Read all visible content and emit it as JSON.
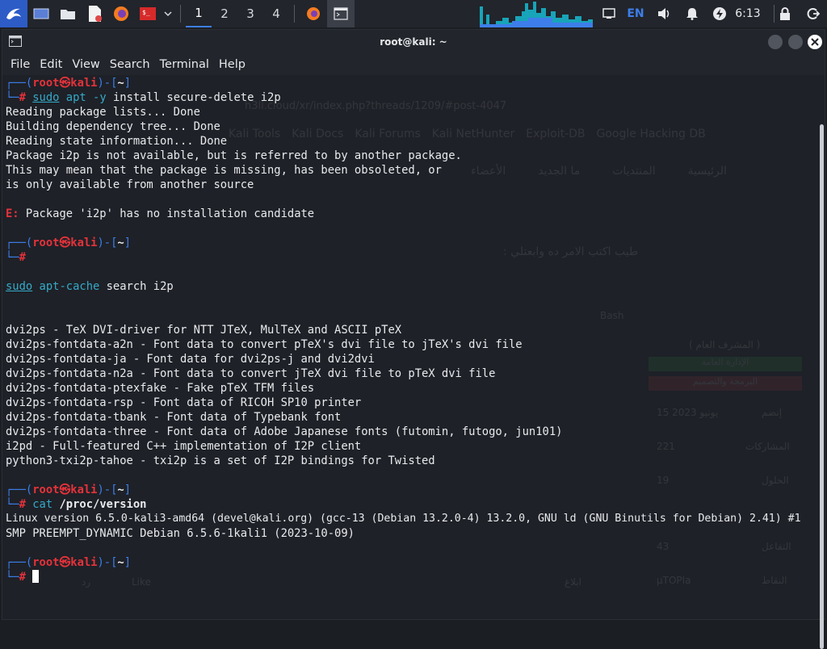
{
  "panel": {
    "workspaces": [
      "1",
      "2",
      "3",
      "4"
    ],
    "keyboard_layout": "EN",
    "clock": "6:13",
    "icons": [
      "kali-menu-icon",
      "show-desktop-icon",
      "file-manager-icon",
      "text-editor-icon",
      "firefox-icon",
      "terminal-icon",
      "window-menu-chevron-icon",
      "network-icon",
      "volume-icon",
      "notification-bell-icon",
      "power-manager-icon",
      "lock-icon",
      "logout-icon"
    ],
    "colors": {
      "panel_bg": "#22252b",
      "accent": "#3d7eea",
      "netgraph": "#17b3c9"
    }
  },
  "window": {
    "title": "root@kali: ~",
    "menu": [
      "File",
      "Edit",
      "View",
      "Search",
      "Terminal",
      "Help"
    ]
  },
  "terminal": {
    "prompt": {
      "open": "┌──(",
      "user": "root",
      "at": "㉿",
      "host": "kali",
      "mid": ")-[",
      "dir": "~",
      "close": "]",
      "second": "└─",
      "hash": "#"
    },
    "cmd1": {
      "sudo": "sudo",
      "apt": "apt",
      "flag": "-y",
      "rest": " install secure-delete i2p"
    },
    "out1": [
      "Reading package lists... Done",
      "Building dependency tree... Done",
      "Reading state information... Done",
      "Package i2p is not available, but is referred to by another package.",
      "This may mean that the package is missing, has been obsoleted, or",
      "is only available from another source"
    ],
    "error": {
      "label": "E:",
      "text": " Package 'i2p' has no installation candidate"
    },
    "cmd2": {
      "sudo": "sudo",
      "tool": "apt-cache",
      "rest": " search i2p"
    },
    "search_results": [
      "dvi2ps - TeX DVI-driver for NTT JTeX, MulTeX and ASCII pTeX",
      "dvi2ps-fontdata-a2n - Font data to convert pTeX's dvi file to jTeX's dvi file",
      "dvi2ps-fontdata-ja - Font data for dvi2ps-j and dvi2dvi",
      "dvi2ps-fontdata-n2a - Font data to convert jTeX dvi file to pTeX dvi file",
      "dvi2ps-fontdata-ptexfake - Fake pTeX TFM files",
      "dvi2ps-fontdata-rsp - Font data of RICOH SP10 printer",
      "dvi2ps-fontdata-tbank - Font data of Typebank font",
      "dvi2ps-fontdata-three - Font data of Adobe Japanese fonts (futomin, futogo, jun101)",
      "i2pd - Full-featured C++ implementation of I2P client",
      "python3-txi2p-tahoe - txi2p is a set of I2P bindings for Twisted"
    ],
    "cmd3": {
      "tool": "cat",
      "rest": " /proc/version"
    },
    "version": [
      "Linux version 6.5.0-kali3-amd64 (devel@kali.org) (gcc-13 (Debian 13.2.0-4) 13.2.0, GNU ld (GNU Binutils for Debian) 2.41) #1",
      "SMP PREEMPT_DYNAMIC Debian 6.5.6-1kali1 (2023-10-09)"
    ]
  },
  "background_page": {
    "url": "h3li.cloud/xr/index.php?threads/1209/#post-4047",
    "bookmarks": [
      "Kali Tools",
      "Kali Docs",
      "Kali Forums",
      "Kali NetHunter",
      "Exploit-DB",
      "Google Hacking DB"
    ],
    "nav": [
      "الرئيسية",
      "المنتديات",
      "ما الجديد",
      "الأعضاء"
    ],
    "post_text": "طيب اكتب الامر ده وابعتلي :",
    "poster_label": "Bash",
    "user_title": "( المشرف العام )",
    "badge1": "الإدارة العامة",
    "badge2": "البرمجة والتصميم",
    "stats": [
      {
        "label": "إنضم",
        "value": "15 يونيو 2023"
      },
      {
        "label": "المشاركات",
        "value": "221"
      },
      {
        "label": "الحلول",
        "value": "19"
      },
      {
        "label": "التفاعل",
        "value": "43"
      },
      {
        "label": "النقاط",
        "value": "μTOPIa"
      }
    ],
    "like": "Like",
    "reply": "رد",
    "report": "ابلاغ"
  }
}
